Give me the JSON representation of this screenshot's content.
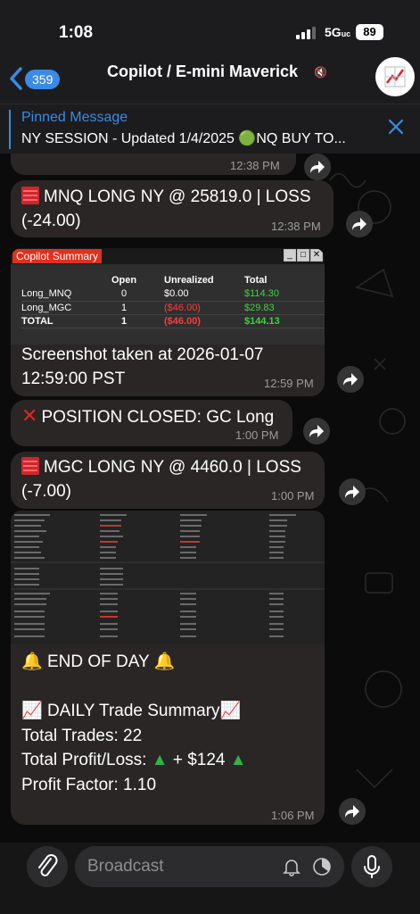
{
  "status_bar": {
    "time": "1:08",
    "network": "5G",
    "network_suffix": "uc",
    "battery": "89"
  },
  "header": {
    "back_count": "359",
    "title": "Copilot / E-mini Maverick"
  },
  "pinned": {
    "title": "Pinned Message",
    "text": "NY SESSION - Updated 1/4/2025 🟢NQ BUY TO..."
  },
  "messages": {
    "m0": {
      "time": "12:38 PM"
    },
    "m1": {
      "text_a": "MNQ LONG NY @ 25819.0 | LOSS",
      "text_b": "(-24.00)",
      "time": "12:38 PM"
    },
    "m2": {
      "panel_title": "Copilot Summary",
      "columns": [
        "",
        "Open",
        "Unrealized",
        "Total"
      ],
      "rows": [
        [
          "Long_MNQ",
          "0",
          "$0.00",
          "$114.30"
        ],
        [
          "Long_MGC",
          "1",
          "($46.00)",
          "$29.83"
        ],
        [
          "TOTAL",
          "1",
          "($46.00)",
          "$144.13"
        ]
      ],
      "caption_a": "Screenshot taken at 2026-01-07",
      "caption_b": "12:59:00 PST",
      "time": "12:59 PM"
    },
    "m3": {
      "text": "POSITION CLOSED: GC Long",
      "time": "1:00 PM"
    },
    "m4": {
      "text_a": "MGC LONG NY @ 4460.0 | LOSS",
      "text_b": "(-7.00)",
      "time": "1:00 PM"
    },
    "m5": {
      "line1": "END OF DAY",
      "line2": "DAILY Trade Summary",
      "line3": "Total Trades: 22",
      "line4_a": "Total Profit/Loss:",
      "line4_b": "+ $124",
      "line5": "Profit Factor: 1.10",
      "time": "1:06 PM"
    }
  },
  "composer": {
    "placeholder": "Broadcast"
  },
  "colors": {
    "accent": "#3a8be6",
    "bubble": "#2a2626",
    "loss_red": "#d0262b",
    "profit_green": "#3dd43d"
  }
}
